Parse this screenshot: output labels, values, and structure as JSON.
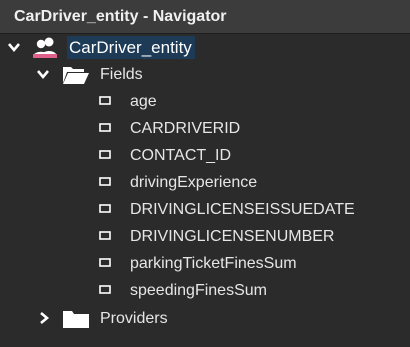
{
  "window": {
    "title": "CarDriver_entity - Navigator"
  },
  "tree": {
    "root": {
      "label": "CarDriver_entity",
      "icon": "users-icon",
      "expanded": true
    },
    "fields": {
      "label": "Fields",
      "icon": "open-folder-icon",
      "expanded": true,
      "items": [
        "age",
        "CARDRIVERID",
        "CONTACT_ID",
        "drivingExperience",
        "DRIVINGLICENSEISSUEDATE",
        "DRIVINGLICENSENUMBER",
        "parkingTicketFinesSum",
        "speedingFinesSum"
      ]
    },
    "providers": {
      "label": "Providers",
      "icon": "folder-icon",
      "expanded": false
    }
  },
  "colors": {
    "background": "#2b2b2b",
    "title_bar": "#3c3c3c",
    "selection": "#1d3a57",
    "users_icon": "#e0608a"
  }
}
